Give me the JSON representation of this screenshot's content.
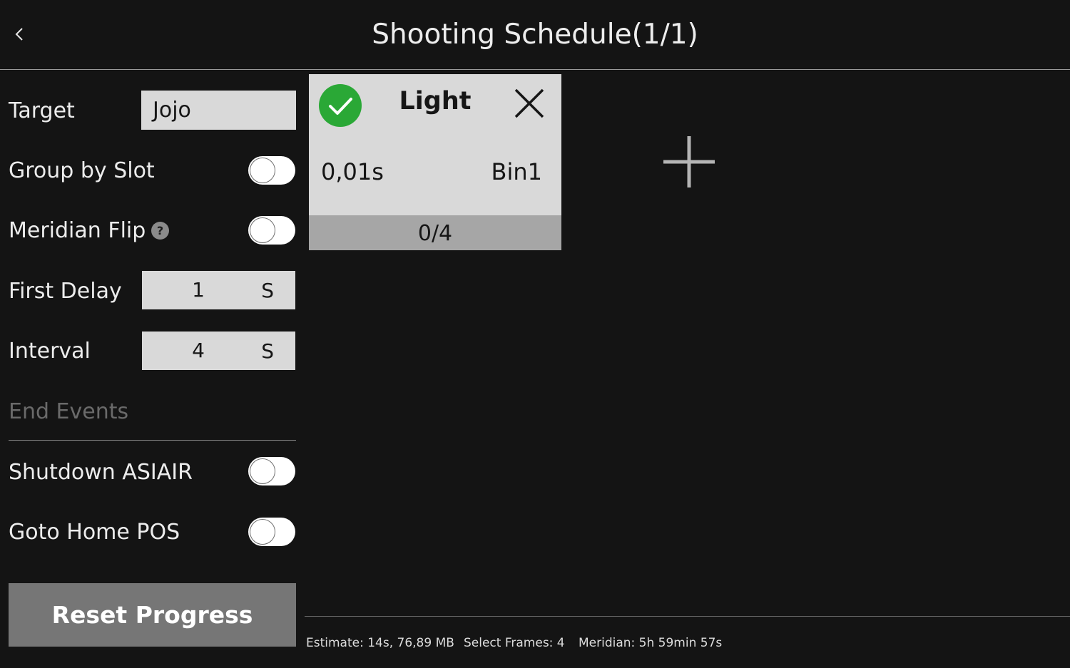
{
  "header": {
    "title": "Shooting Schedule(1/1)",
    "back_icon": "chevron-left-icon"
  },
  "settings": {
    "target_label": "Target",
    "target_value": "Jojo",
    "group_by_slot_label": "Group by Slot",
    "group_by_slot_on": false,
    "meridian_flip_label": "Meridian Flip",
    "meridian_flip_on": false,
    "help_glyph": "?",
    "first_delay_label": "First Delay",
    "first_delay_value": "1",
    "first_delay_unit": "S",
    "interval_label": "Interval",
    "interval_value": "4",
    "interval_unit": "S"
  },
  "end_events": {
    "section_label": "End Events",
    "shutdown_label": "Shutdown ASIAIR",
    "shutdown_on": false,
    "goto_home_label": "Goto Home POS",
    "goto_home_on": false
  },
  "reset_label": "Reset Progress",
  "frame_card": {
    "type": "Light",
    "enabled": true,
    "exposure": "0,01s",
    "binning": "Bin1",
    "progress_text": "0/4",
    "check_color": "#2aa836"
  },
  "footer": {
    "estimate": "Estimate: 14s, 76,89 MB",
    "select_frames": "Select Frames: 4",
    "meridian": "Meridian: 5h 59min 57s"
  }
}
